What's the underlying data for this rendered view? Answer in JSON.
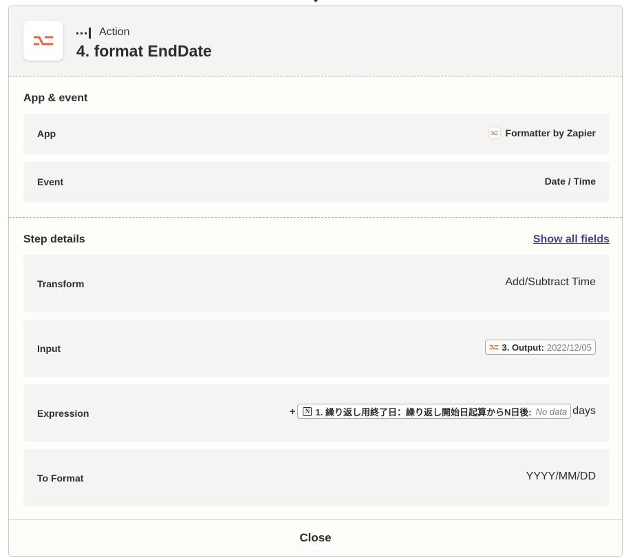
{
  "header": {
    "step_type": "Action",
    "title": "4. format EndDate",
    "icon": "formatter-icon",
    "accent": "#e8643c"
  },
  "sections": {
    "app_event_title": "App & event",
    "step_details_title": "Step details",
    "show_all_label": "Show all fields"
  },
  "app_event": {
    "app_label": "App",
    "app_value": "Formatter by Zapier",
    "event_label": "Event",
    "event_value": "Date / Time"
  },
  "step_details": {
    "transform_label": "Transform",
    "transform_value": "Add/Subtract Time",
    "input_label": "Input",
    "input_pill_step": "3. Output:",
    "input_pill_value": "2022/12/05",
    "expression_label": "Expression",
    "expression_prefix": "+",
    "expression_pill_step": "1. 繰り返し用終了日：繰り返し開始日起算からN日後:",
    "expression_pill_value": "No data",
    "expression_suffix": "days",
    "to_format_label": "To Format",
    "to_format_value": "YYYY/MM/DD"
  },
  "footer": {
    "close_label": "Close"
  }
}
